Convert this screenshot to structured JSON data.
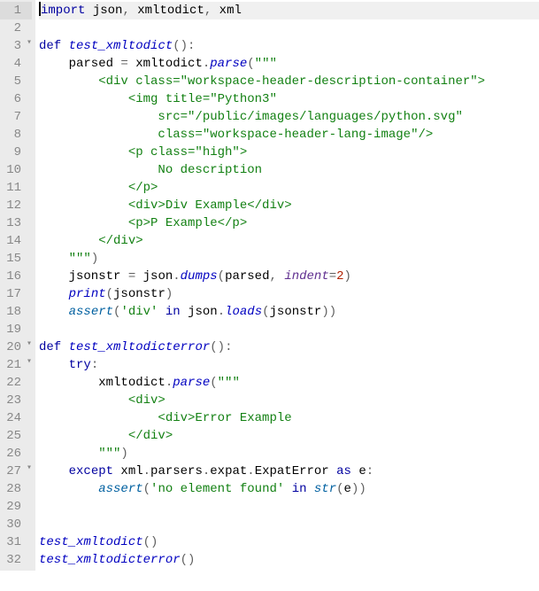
{
  "editor": {
    "active_line": 1,
    "language": "python",
    "lines": [
      {
        "n": 1,
        "fold": "",
        "tokens": [
          [
            "kw",
            "import"
          ],
          [
            "name",
            " json"
          ],
          [
            "op",
            ","
          ],
          [
            "name",
            " xmltodict"
          ],
          [
            "op",
            ","
          ],
          [
            "name",
            " xml"
          ]
        ]
      },
      {
        "n": 2,
        "fold": "",
        "tokens": []
      },
      {
        "n": 3,
        "fold": "open",
        "tokens": [
          [
            "kw",
            "def"
          ],
          [
            "name",
            " "
          ],
          [
            "fn",
            "test_xmltodict"
          ],
          [
            "op",
            "():"
          ]
        ]
      },
      {
        "n": 4,
        "fold": "",
        "tokens": [
          [
            "name",
            "    parsed "
          ],
          [
            "op",
            "="
          ],
          [
            "name",
            " xmltodict"
          ],
          [
            "op",
            "."
          ],
          [
            "fn",
            "parse"
          ],
          [
            "op",
            "("
          ],
          [
            "str",
            "\"\"\""
          ]
        ]
      },
      {
        "n": 5,
        "fold": "",
        "tokens": [
          [
            "str",
            "        <div class=\"workspace-header-description-container\">"
          ]
        ]
      },
      {
        "n": 6,
        "fold": "",
        "tokens": [
          [
            "str",
            "            <img title=\"Python3\" "
          ]
        ]
      },
      {
        "n": 7,
        "fold": "",
        "tokens": [
          [
            "str",
            "                src=\"/public/images/languages/python.svg\" "
          ]
        ]
      },
      {
        "n": 8,
        "fold": "",
        "tokens": [
          [
            "str",
            "                class=\"workspace-header-lang-image\"/>"
          ]
        ]
      },
      {
        "n": 9,
        "fold": "",
        "tokens": [
          [
            "str",
            "            <p class=\"high\">"
          ]
        ]
      },
      {
        "n": 10,
        "fold": "",
        "tokens": [
          [
            "str",
            "                No description"
          ]
        ]
      },
      {
        "n": 11,
        "fold": "",
        "tokens": [
          [
            "str",
            "            </p>"
          ]
        ]
      },
      {
        "n": 12,
        "fold": "",
        "tokens": [
          [
            "str",
            "            <div>Div Example</div>"
          ]
        ]
      },
      {
        "n": 13,
        "fold": "",
        "tokens": [
          [
            "str",
            "            <p>P Example</p>"
          ]
        ]
      },
      {
        "n": 14,
        "fold": "",
        "tokens": [
          [
            "str",
            "        </div>"
          ]
        ]
      },
      {
        "n": 15,
        "fold": "",
        "tokens": [
          [
            "str",
            "    \"\"\""
          ],
          [
            "op",
            ")"
          ]
        ]
      },
      {
        "n": 16,
        "fold": "",
        "tokens": [
          [
            "name",
            "    jsonstr "
          ],
          [
            "op",
            "="
          ],
          [
            "name",
            " json"
          ],
          [
            "op",
            "."
          ],
          [
            "fn",
            "dumps"
          ],
          [
            "op",
            "("
          ],
          [
            "name",
            "parsed"
          ],
          [
            "op",
            ", "
          ],
          [
            "arg",
            "indent"
          ],
          [
            "op",
            "="
          ],
          [
            "num",
            "2"
          ],
          [
            "op",
            ")"
          ]
        ]
      },
      {
        "n": 17,
        "fold": "",
        "tokens": [
          [
            "name",
            "    "
          ],
          [
            "fn",
            "print"
          ],
          [
            "op",
            "("
          ],
          [
            "name",
            "jsonstr"
          ],
          [
            "op",
            ")"
          ]
        ]
      },
      {
        "n": 18,
        "fold": "",
        "tokens": [
          [
            "name",
            "    "
          ],
          [
            "builtin",
            "assert"
          ],
          [
            "op",
            "("
          ],
          [
            "str",
            "'div'"
          ],
          [
            "name",
            " "
          ],
          [
            "kw",
            "in"
          ],
          [
            "name",
            " json"
          ],
          [
            "op",
            "."
          ],
          [
            "fn",
            "loads"
          ],
          [
            "op",
            "("
          ],
          [
            "name",
            "jsonstr"
          ],
          [
            "op",
            "))"
          ]
        ]
      },
      {
        "n": 19,
        "fold": "",
        "tokens": []
      },
      {
        "n": 20,
        "fold": "open",
        "tokens": [
          [
            "kw",
            "def"
          ],
          [
            "name",
            " "
          ],
          [
            "fn",
            "test_xmltodicterror"
          ],
          [
            "op",
            "():"
          ]
        ]
      },
      {
        "n": 21,
        "fold": "open",
        "tokens": [
          [
            "name",
            "    "
          ],
          [
            "kw",
            "try"
          ],
          [
            "op",
            ":"
          ]
        ]
      },
      {
        "n": 22,
        "fold": "",
        "tokens": [
          [
            "name",
            "        xmltodict"
          ],
          [
            "op",
            "."
          ],
          [
            "fn",
            "parse"
          ],
          [
            "op",
            "("
          ],
          [
            "str",
            "\"\"\""
          ]
        ]
      },
      {
        "n": 23,
        "fold": "",
        "tokens": [
          [
            "str",
            "            <div>"
          ]
        ]
      },
      {
        "n": 24,
        "fold": "",
        "tokens": [
          [
            "str",
            "                <div>Error Example"
          ]
        ]
      },
      {
        "n": 25,
        "fold": "",
        "tokens": [
          [
            "str",
            "            </div>"
          ]
        ]
      },
      {
        "n": 26,
        "fold": "",
        "tokens": [
          [
            "str",
            "        \"\"\""
          ],
          [
            "op",
            ")"
          ]
        ]
      },
      {
        "n": 27,
        "fold": "open",
        "tokens": [
          [
            "name",
            "    "
          ],
          [
            "kw",
            "except"
          ],
          [
            "name",
            " xml"
          ],
          [
            "op",
            "."
          ],
          [
            "name",
            "parsers"
          ],
          [
            "op",
            "."
          ],
          [
            "name",
            "expat"
          ],
          [
            "op",
            "."
          ],
          [
            "name",
            "ExpatError "
          ],
          [
            "kw",
            "as"
          ],
          [
            "name",
            " e"
          ],
          [
            "op",
            ":"
          ]
        ]
      },
      {
        "n": 28,
        "fold": "",
        "tokens": [
          [
            "name",
            "        "
          ],
          [
            "builtin",
            "assert"
          ],
          [
            "op",
            "("
          ],
          [
            "str",
            "'no element found'"
          ],
          [
            "name",
            " "
          ],
          [
            "kw",
            "in"
          ],
          [
            "name",
            " "
          ],
          [
            "builtin",
            "str"
          ],
          [
            "op",
            "("
          ],
          [
            "name",
            "e"
          ],
          [
            "op",
            "))"
          ]
        ]
      },
      {
        "n": 29,
        "fold": "",
        "tokens": []
      },
      {
        "n": 30,
        "fold": "",
        "tokens": []
      },
      {
        "n": 31,
        "fold": "",
        "tokens": [
          [
            "fn",
            "test_xmltodict"
          ],
          [
            "op",
            "()"
          ]
        ]
      },
      {
        "n": 32,
        "fold": "",
        "tokens": [
          [
            "fn",
            "test_xmltodicterror"
          ],
          [
            "op",
            "()"
          ]
        ]
      }
    ]
  }
}
